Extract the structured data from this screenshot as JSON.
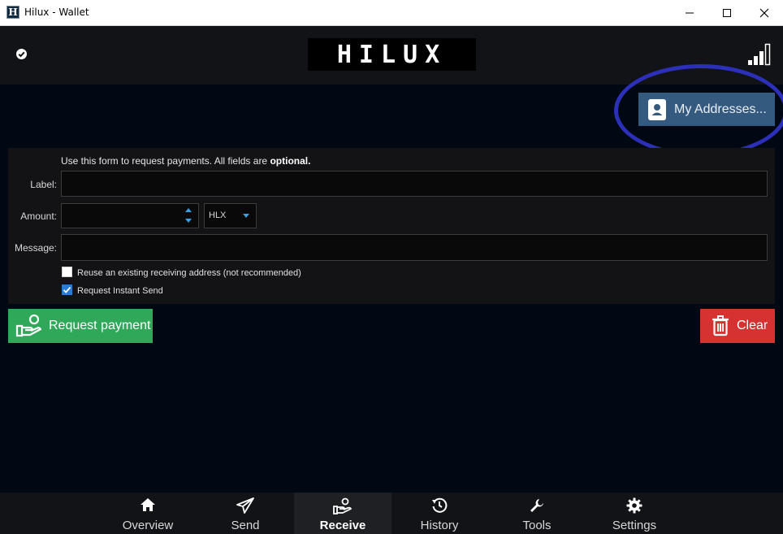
{
  "window": {
    "title": "Hilux - Wallet",
    "minimize_icon": "minimize-icon",
    "maximize_icon": "maximize-icon",
    "close_icon": "close-icon"
  },
  "header": {
    "logo_text": "HILUX",
    "status_icon": "check-circle-icon",
    "signal_icon": "signal-bars-icon"
  },
  "addresses_button": {
    "label": "My Addresses...",
    "icon": "address-book-icon"
  },
  "form": {
    "intro_text": "Use this form to request payments. All fields are ",
    "intro_bold": "optional.",
    "label_label": "Label:",
    "label_value": "",
    "amount_label": "Amount:",
    "amount_value": "",
    "unit_value": "HLX",
    "message_label": "Message:",
    "message_value": "",
    "reuse_label": "Reuse an existing receiving address (not recommended)",
    "reuse_checked": false,
    "instant_label": "Request Instant Send",
    "instant_checked": true
  },
  "actions": {
    "request_label": "Request payment",
    "request_icon": "hand-coin-icon",
    "clear_label": "Clear",
    "clear_icon": "trash-icon"
  },
  "nav": {
    "items": [
      {
        "label": "Overview",
        "icon": "home-icon"
      },
      {
        "label": "Send",
        "icon": "paper-plane-icon"
      },
      {
        "label": "Receive",
        "icon": "hand-coin-icon"
      },
      {
        "label": "History",
        "icon": "history-icon"
      },
      {
        "label": "Tools",
        "icon": "wrench-icon"
      },
      {
        "label": "Settings",
        "icon": "gear-icon"
      }
    ],
    "active_index": 2
  },
  "colors": {
    "accent_blue": "#355a80",
    "request_green": "#2fa85a",
    "clear_red": "#d63232",
    "highlight_ring": "#2c2fb8"
  }
}
